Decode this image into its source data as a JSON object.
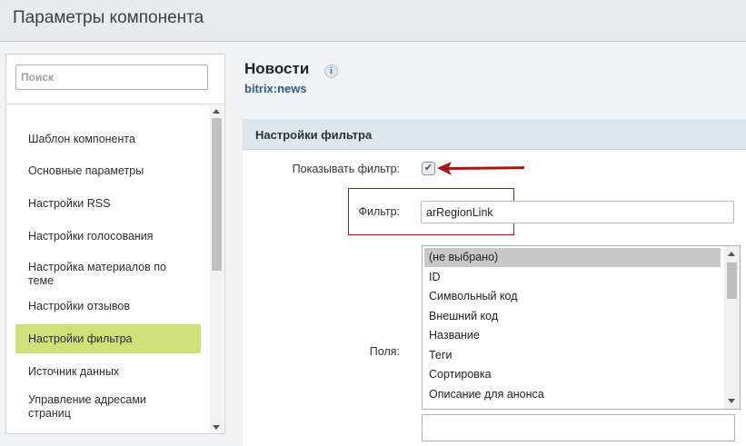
{
  "window": {
    "title": "Параметры компонента"
  },
  "search": {
    "placeholder": "Поиск"
  },
  "sidebar": {
    "items": [
      {
        "label": "Шаблон компонента"
      },
      {
        "label": "Основные параметры"
      },
      {
        "label": "Настройки RSS"
      },
      {
        "label": "Настройки голосования"
      },
      {
        "label": "Настройка материалов по теме"
      },
      {
        "label": "Настройки отзывов"
      },
      {
        "label": "Настройки фильтра",
        "active": true
      },
      {
        "label": "Источник данных"
      },
      {
        "label": "Управление адресами страниц"
      }
    ]
  },
  "component": {
    "name": "Новости",
    "id": "bitrix:news",
    "info_icon": "i"
  },
  "section": {
    "title": "Настройки фильтра"
  },
  "form": {
    "show_filter_label": "Показывать фильтр:",
    "show_filter_checked": true,
    "filter_label": "Фильтр:",
    "filter_value": "arRegionLink",
    "fields_label": "Поля:",
    "field_options": [
      "(не выбрано)",
      "ID",
      "Символьный код",
      "Внешний код",
      "Название",
      "Теги",
      "Сортировка",
      "Описание для анонса"
    ],
    "selected_option": "(не выбрано)"
  },
  "colors": {
    "active_item": "#cfe07a",
    "annotation_red": "#a01818",
    "link_blue": "#2b5c8c"
  }
}
